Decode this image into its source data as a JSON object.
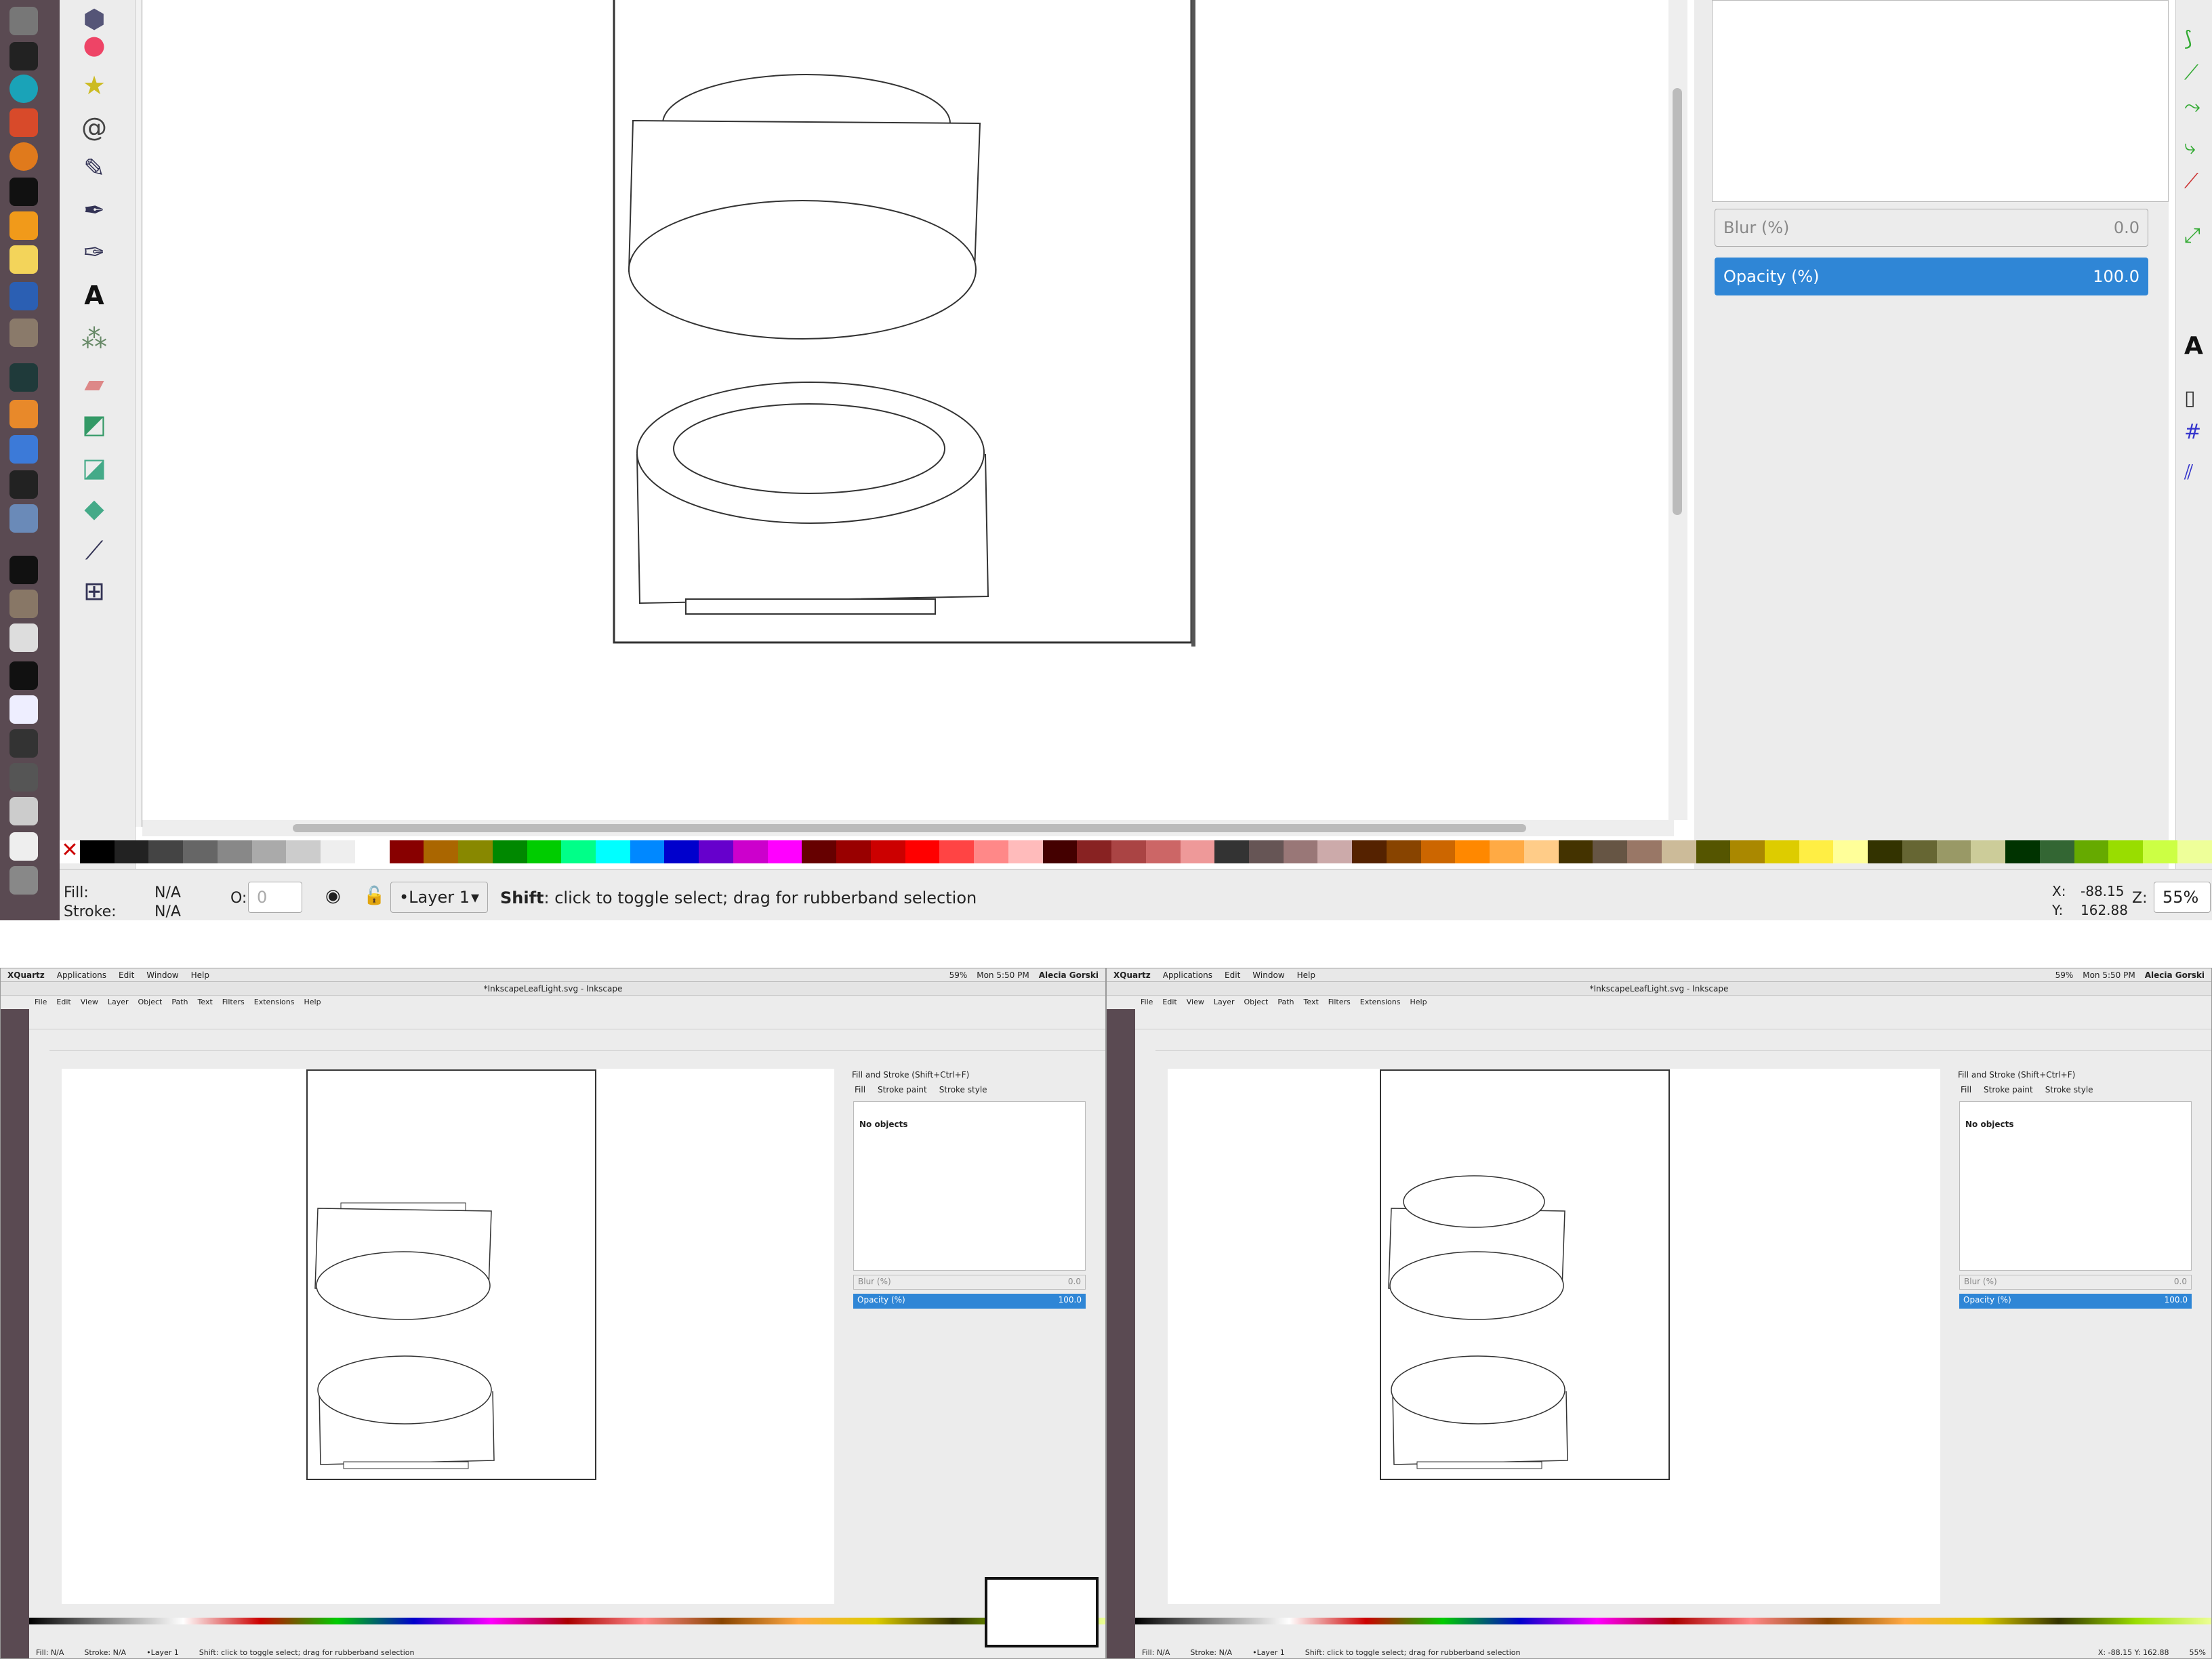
{
  "colors": {
    "accent_blue": "#2f86d6",
    "dock_bg": "#5a4a52",
    "panel_bg": "#ececec"
  },
  "top": {
    "panel": {
      "blur_label": "Blur (%)",
      "blur_value": "0.0",
      "opacity_label": "Opacity (%)",
      "opacity_value": "100.0"
    },
    "status": {
      "fill_label": "Fill:",
      "fill_value": "N/A",
      "stroke_label": "Stroke:",
      "stroke_value": "N/A",
      "opacity_prefix": "O:",
      "opacity_value": "0",
      "layer": "•Layer 1",
      "hint_bold": "Shift",
      "hint_text": ": click to toggle select; drag for rubberband selection",
      "x_label": "X:",
      "x_value": "-88.15",
      "y_label": "Y:",
      "y_value": "162.88",
      "z_label": "Z:",
      "zoom": "55%"
    }
  },
  "screens": [
    {
      "menubar": {
        "app": "XQuartz",
        "items": [
          "Applications",
          "Edit",
          "Window",
          "Help"
        ],
        "right": [
          "59%",
          "Mon 5:50 PM",
          "Alecia Gorski"
        ]
      },
      "window_title": "*InkscapeLeafLight.svg - Inkscape",
      "menu": [
        "File",
        "Edit",
        "View",
        "Layer",
        "Object",
        "Path",
        "Text",
        "Filters",
        "Extensions",
        "Help"
      ],
      "panel": {
        "title": "Fill and Stroke (Shift+Ctrl+F)",
        "tabs": [
          "Fill",
          "Stroke paint",
          "Stroke style"
        ],
        "no_objects": "No objects",
        "blur_label": "Blur (%)",
        "blur_value": "0.0",
        "opacity_label": "Opacity (%)",
        "opacity_value": "100.0"
      },
      "status": {
        "fill": "Fill: N/A",
        "stroke": "Stroke: N/A",
        "layer": "•Layer 1",
        "hint": "Shift: click to toggle select; drag for rubberband selection"
      }
    },
    {
      "menubar": {
        "app": "XQuartz",
        "items": [
          "Applications",
          "Edit",
          "Window",
          "Help"
        ],
        "right": [
          "59%",
          "Mon 5:50 PM",
          "Alecia Gorski"
        ]
      },
      "window_title": "*InkscapeLeafLight.svg - Inkscape",
      "menu": [
        "File",
        "Edit",
        "View",
        "Layer",
        "Object",
        "Path",
        "Text",
        "Filters",
        "Extensions",
        "Help"
      ],
      "panel": {
        "title": "Fill and Stroke (Shift+Ctrl+F)",
        "tabs": [
          "Fill",
          "Stroke paint",
          "Stroke style"
        ],
        "no_objects": "No objects",
        "blur_label": "Blur (%)",
        "blur_value": "0.0",
        "opacity_label": "Opacity (%)",
        "opacity_value": "100.0"
      },
      "status": {
        "fill": "Fill: N/A",
        "stroke": "Stroke: N/A",
        "layer": "•Layer 1",
        "hint": "Shift: click to toggle select; drag for rubberband selection",
        "coords": "X: -88.15 Y: 162.88",
        "zoom": "55%"
      }
    }
  ]
}
